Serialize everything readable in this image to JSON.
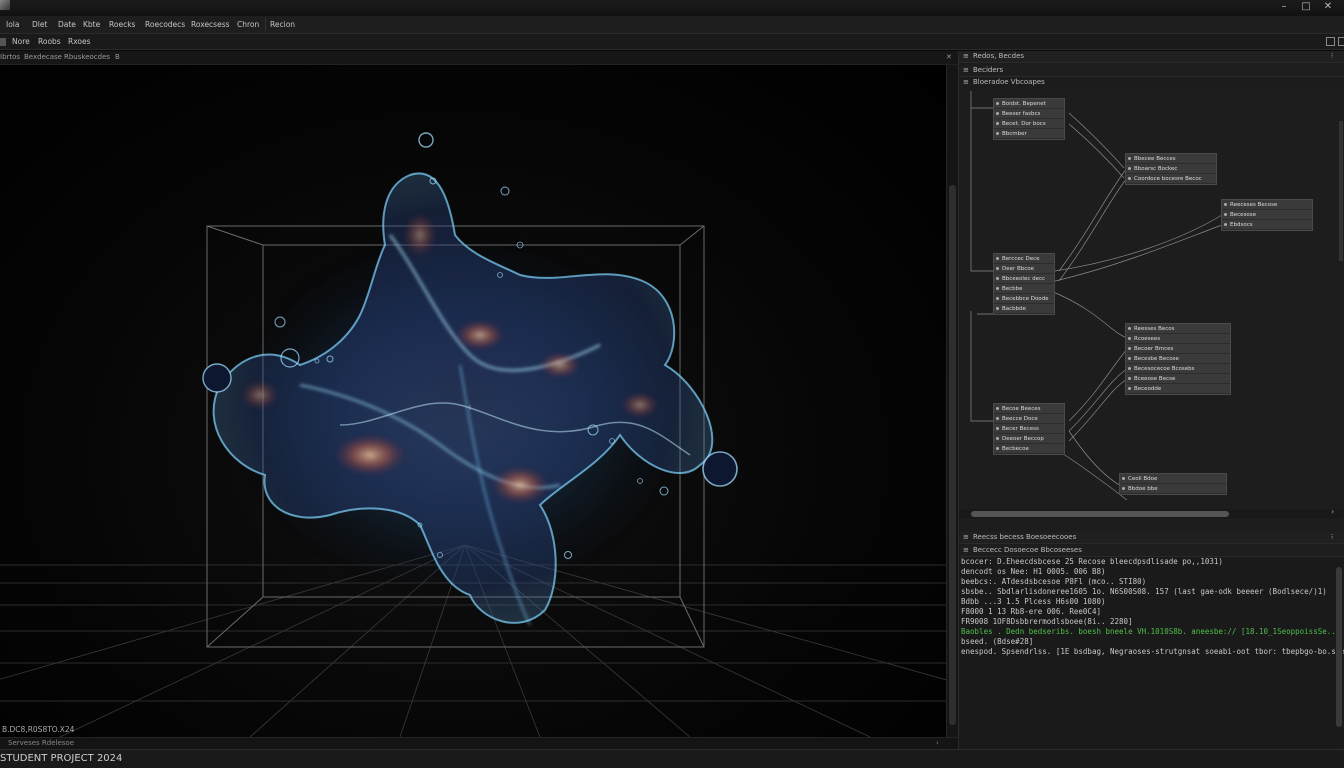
{
  "window": {
    "minimize": "–",
    "maximize": "□",
    "close": "✕"
  },
  "menu": [
    "Iola",
    "Dlet",
    "Date",
    "Kbte",
    "Roecks",
    "Roecodecs",
    "Roxecsess",
    "Chron",
    "Recion"
  ],
  "toolbar": {
    "items": [
      "Nore",
      "Roobs",
      "Rxoes"
    ]
  },
  "viewport": {
    "tabs": [
      "Ibrtos",
      "Bexdecase",
      "Rbuskeocdes",
      "B"
    ],
    "close": "✕",
    "coords": "B.DC8,R0S8TO.X24",
    "footer_label": "Serveses Rdelesoe",
    "footer_arrow": "›"
  },
  "status": {
    "text": "STUDENT PROJECT 2024"
  },
  "node_panel": {
    "title": "Redos, Becdes",
    "subtitle": "Beciders",
    "header": "Bloeradoe Vbcoapes",
    "nodes": [
      {
        "rows": [
          "Boidst. Bepenet",
          "Beeser fasbcs",
          "Becet. Dor bocs",
          "Bbcmber"
        ]
      },
      {
        "rows": [
          "Bbecee Becces",
          "Bboarsc Bockec",
          "Coordoce bocesre Becoc"
        ]
      },
      {
        "rows": [
          "Reeceses Becose",
          "Becesose",
          "Ebdsocs"
        ]
      },
      {
        "rows": [
          "Berccec Dece",
          "Deer Bbcoe",
          "Bbceeolec decc",
          "Becbbe",
          "Becebbce Doode",
          "Bacbbde"
        ]
      },
      {
        "rows": [
          "Reesses Becos",
          "Rcoesees",
          "Becoer Bmces",
          "Becesbe Becose",
          "Becesocecoe Bcosebs",
          "Bceeose Becse",
          "Beceodde"
        ]
      },
      {
        "rows": [
          "Becoe Beeces",
          "Beecce Doce",
          "Becer Becess",
          "Deeoer Beccop",
          "Becbecoe"
        ]
      },
      {
        "rows": [
          "Ceoli Bdoe",
          "Bbdoe bbe"
        ]
      }
    ]
  },
  "console": {
    "title": "Reecss becess Boesoeecooes",
    "subtitle": "Beccecc Dosoecoe Bbcoseeses",
    "lines": [
      {
        "text": "bcocer: D.Eheecdsbcese 25 Recose bleecdpsdlisade po,,1031)",
        "green": false
      },
      {
        "text": "dencodt os Nee: H1 0005. 006 B8)",
        "green": false
      },
      {
        "text": "beebcs:. ATdesdsbcesoe P8Fl (mco.. STI80)",
        "green": false
      },
      {
        "text": "sbsbe.. Sbdlarlisdoneree1605 1o. N6S00S08. 157 (last gae-odk beeeer (Bodlsece/)1)",
        "green": false
      },
      {
        "text": "Bdbb ...3 1.5 Plcess H6s00 1080)",
        "green": false
      },
      {
        "text": "F8000 1 13 Rb8-ere 006. Ree0C4]",
        "green": false
      },
      {
        "text": "FR9008 1OF8Dsbbrermodlsboee(8i.. 2280]",
        "green": false
      },
      {
        "text": "Baobles  . Dedn bedseribs.  boesh bneele VH.1010S8b. aneesbe:// [18.10_1SeoppoissSe... 5hsse.30)",
        "green": true
      },
      {
        "text": "bseed.  (Bdse#28]",
        "green": false
      },
      {
        "text": "enespod. Spsendrlss. [1E  bsdbag, Negraoses-strutgnsat  soeabi-oot  tbor:  tbepbgo-bo.sse.,1bsoo)",
        "green": false
      }
    ]
  }
}
